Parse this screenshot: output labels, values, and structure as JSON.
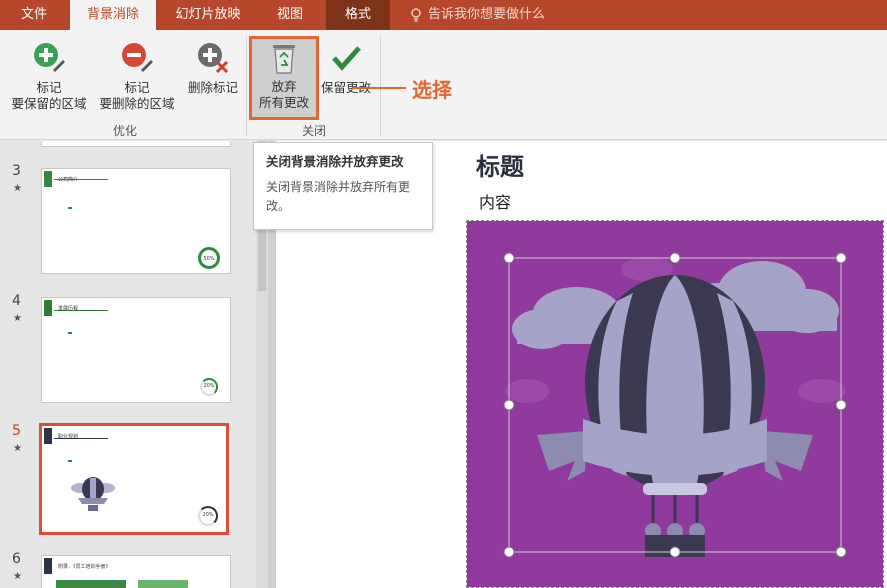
{
  "tabs": [
    {
      "label": "文件",
      "state": "normal"
    },
    {
      "label": "背景消除",
      "state": "active"
    },
    {
      "label": "幻灯片放映",
      "state": "normal"
    },
    {
      "label": "视图",
      "state": "normal"
    },
    {
      "label": "格式",
      "state": "contextual"
    }
  ],
  "tell_me": "告诉我你想要做什么",
  "ribbon": {
    "mark_keep": {
      "line1": "标记",
      "line2": "要保留的区域",
      "icon": "plus-pencil-icon"
    },
    "mark_remove": {
      "line1": "标记",
      "line2": "要删除的区域",
      "icon": "minus-pencil-icon"
    },
    "delete_mark": {
      "label": "删除标记",
      "icon": "delete-mark-icon"
    },
    "discard": {
      "line1": "放弃",
      "line2": "所有更改",
      "icon": "recycle-bin-icon"
    },
    "keep": {
      "label": "保留更改",
      "icon": "checkmark-icon"
    },
    "group_refine": "优化",
    "group_close": "关闭"
  },
  "annotation": "选择",
  "tooltip": {
    "title": "关闭背景消除并放弃更改",
    "body": "关闭背景消除并放弃所有更改。"
  },
  "thumbnails": [
    {
      "number": "3",
      "title": "公司简介",
      "percent": "50%",
      "accent": "#2e8b3e",
      "selected": false
    },
    {
      "number": "4",
      "title": "发展历程",
      "percent": "20%",
      "accent": "#2e7d32",
      "selected": false
    },
    {
      "number": "5",
      "title": "职业规划",
      "percent": "20%",
      "accent": "#2e3448",
      "selected": true
    },
    {
      "number": "6",
      "title": "附录：《员工培训手册》",
      "percent": "",
      "accent": "#2e3448",
      "selected": false
    }
  ],
  "slide": {
    "title": "标题",
    "content": "内容"
  },
  "colors": {
    "tab_bar": "#b7472a",
    "highlight": "#e0672f",
    "picture_bg": "#8f3a9c",
    "balloon_dark": "#3b3950",
    "balloon_light": "#a6a3c8"
  }
}
